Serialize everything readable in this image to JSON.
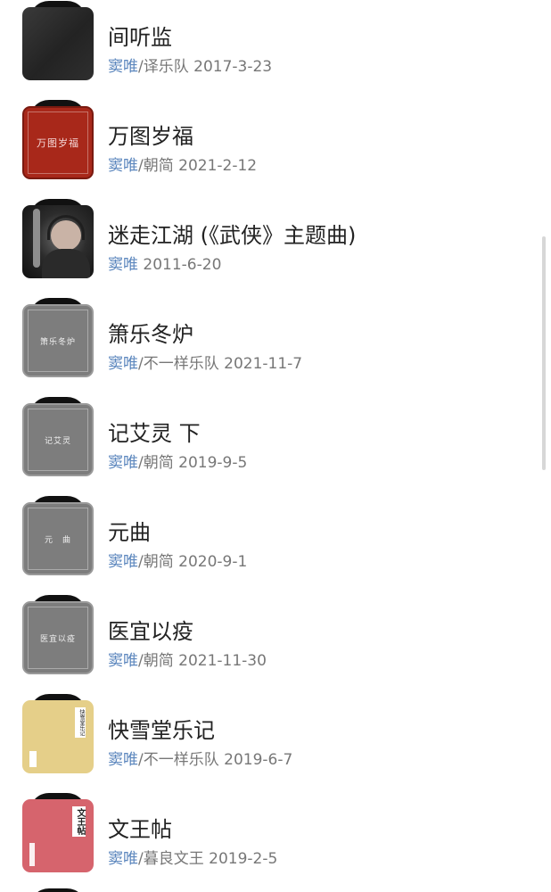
{
  "songs": [
    {
      "title": "间听监",
      "artist": "窦唯",
      "detail": "/译乐队 2017-3-23",
      "cover_style": "dark",
      "cover_text": "",
      "cover_small": ""
    },
    {
      "title": "万图岁福",
      "artist": "窦唯",
      "detail": "/朝简 2021-2-12",
      "cover_style": "red",
      "cover_text": "万图岁福",
      "cover_small": ""
    },
    {
      "title": "迷走江湖 (《武侠》主题曲)",
      "artist": "窦唯",
      "detail": " 2011-6-20",
      "cover_style": "photo",
      "cover_text": "",
      "cover_small": ""
    },
    {
      "title": "箫乐冬炉",
      "artist": "窦唯",
      "detail": "/不一样乐队 2021-11-7",
      "cover_style": "gray",
      "cover_text": "箫乐冬炉",
      "cover_small": ""
    },
    {
      "title": "记艾灵 下",
      "artist": "窦唯",
      "detail": "/朝简 2019-9-5",
      "cover_style": "gray",
      "cover_text": "记艾灵",
      "cover_small": ""
    },
    {
      "title": "元曲",
      "artist": "窦唯",
      "detail": "/朝简 2020-9-1",
      "cover_style": "gray",
      "cover_text": "元　曲",
      "cover_small": ""
    },
    {
      "title": "医宜以疫",
      "artist": "窦唯",
      "detail": "/朝简 2021-11-30",
      "cover_style": "gray",
      "cover_text": "医宜以疫",
      "cover_small": ""
    },
    {
      "title": "快雪堂乐记",
      "artist": "窦唯",
      "detail": "/不一样乐队 2019-6-7",
      "cover_style": "yellow",
      "cover_text": "",
      "cover_small": ""
    },
    {
      "title": "文王帖",
      "artist": "窦唯",
      "detail": "/暮良文王 2019-2-5",
      "cover_style": "pink",
      "cover_text": "",
      "cover_small": ""
    }
  ],
  "cover_labels": {
    "yellow_vertical": "快雪堂乐记",
    "pink_vertical": "文王帖"
  },
  "colors": {
    "artist_link": "#5b86bd",
    "meta_text": "#777777",
    "title_text": "#222222",
    "scrollbar": "#d7d7d7"
  }
}
